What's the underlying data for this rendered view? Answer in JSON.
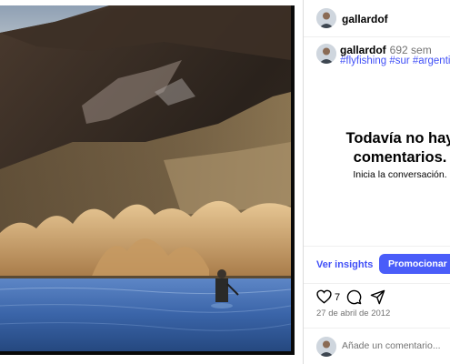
{
  "post": {
    "username": "gallardof",
    "caption_time": "692 sem",
    "hashtags": "#flyfishing #sur #argentina",
    "likes": "7",
    "date": "27 de abril de 2012"
  },
  "comments": {
    "empty_title": "Todavía no hay comentarios.",
    "empty_subtitle": "Inicia la conversación."
  },
  "actions": {
    "insights_label": "Ver insights",
    "promote_label": "Promocionar publicación"
  },
  "comment_box": {
    "placeholder": "Añade un comentario..."
  },
  "icons": {
    "like": "heart-icon",
    "comment": "comment-icon",
    "share": "share-icon"
  },
  "colors": {
    "accent": "#4150f7",
    "button": "#4a5df9",
    "muted": "#737373"
  }
}
